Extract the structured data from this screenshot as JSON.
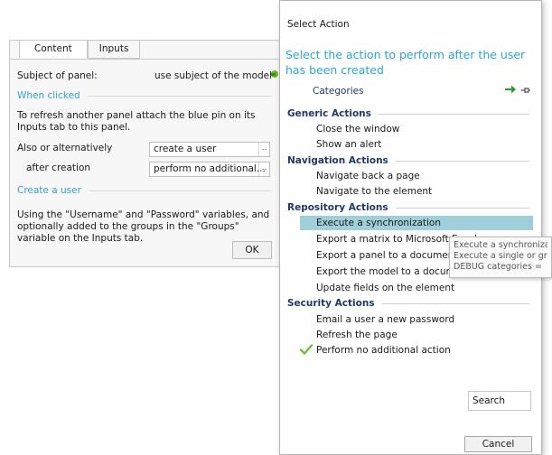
{
  "panel": {
    "tabs": [
      {
        "label": "Content",
        "active": true
      },
      {
        "label": "Inputs",
        "active": false
      }
    ],
    "subject_label": "Subject of panel:",
    "subject_value": "use subject of the model",
    "when_clicked_section": "When clicked",
    "refresh_text": "To refresh another panel attach the blue pin on its Inputs tab to this panel.",
    "also_label": "Also or alternatively",
    "also_value": "create a user",
    "after_label": "after creation",
    "after_value": "perform  no  additional...",
    "create_user_section": "Create a user",
    "create_user_text": "Using the \"Username\" and \"Password\" variables, and optionally added to the groups in the \"Groups\" variable on the Inputs tab.",
    "ok_label": "OK",
    "dropdown_glyph": ".."
  },
  "dialog": {
    "title": "Select Action",
    "heading": "Select the action to perform after the user has been created",
    "categories_label": "Categories",
    "groups": [
      {
        "name": "Generic Actions",
        "actions": [
          "Close the window",
          "Show an alert"
        ]
      },
      {
        "name": "Navigation Actions",
        "actions": [
          "Navigate back a page",
          "Navigate to the element"
        ]
      },
      {
        "name": "Repository Actions",
        "actions": [
          "Execute a synchronization",
          "Export a matrix to Microsoft Excel",
          "Export a panel to a document",
          "Export the model to a document",
          "Update fields on the element"
        ]
      },
      {
        "name": "Security Actions",
        "actions": [
          "Email a user a new password",
          "Refresh the page",
          "Perform no additional action"
        ]
      }
    ],
    "selected_action": "Execute a synchronization",
    "current_action": "Perform no additional action",
    "search_label": "Search",
    "cancel_label": "Cancel"
  },
  "tooltip": {
    "lines": [
      "Execute a synchronizati",
      "Execute a single or grou",
      "DEBUG categories ="
    ]
  },
  "colors": {
    "accent": "#2aa6d6",
    "selection": "#9ecfdb",
    "group_header": "#1f3a66",
    "check": "#6cc13f"
  }
}
